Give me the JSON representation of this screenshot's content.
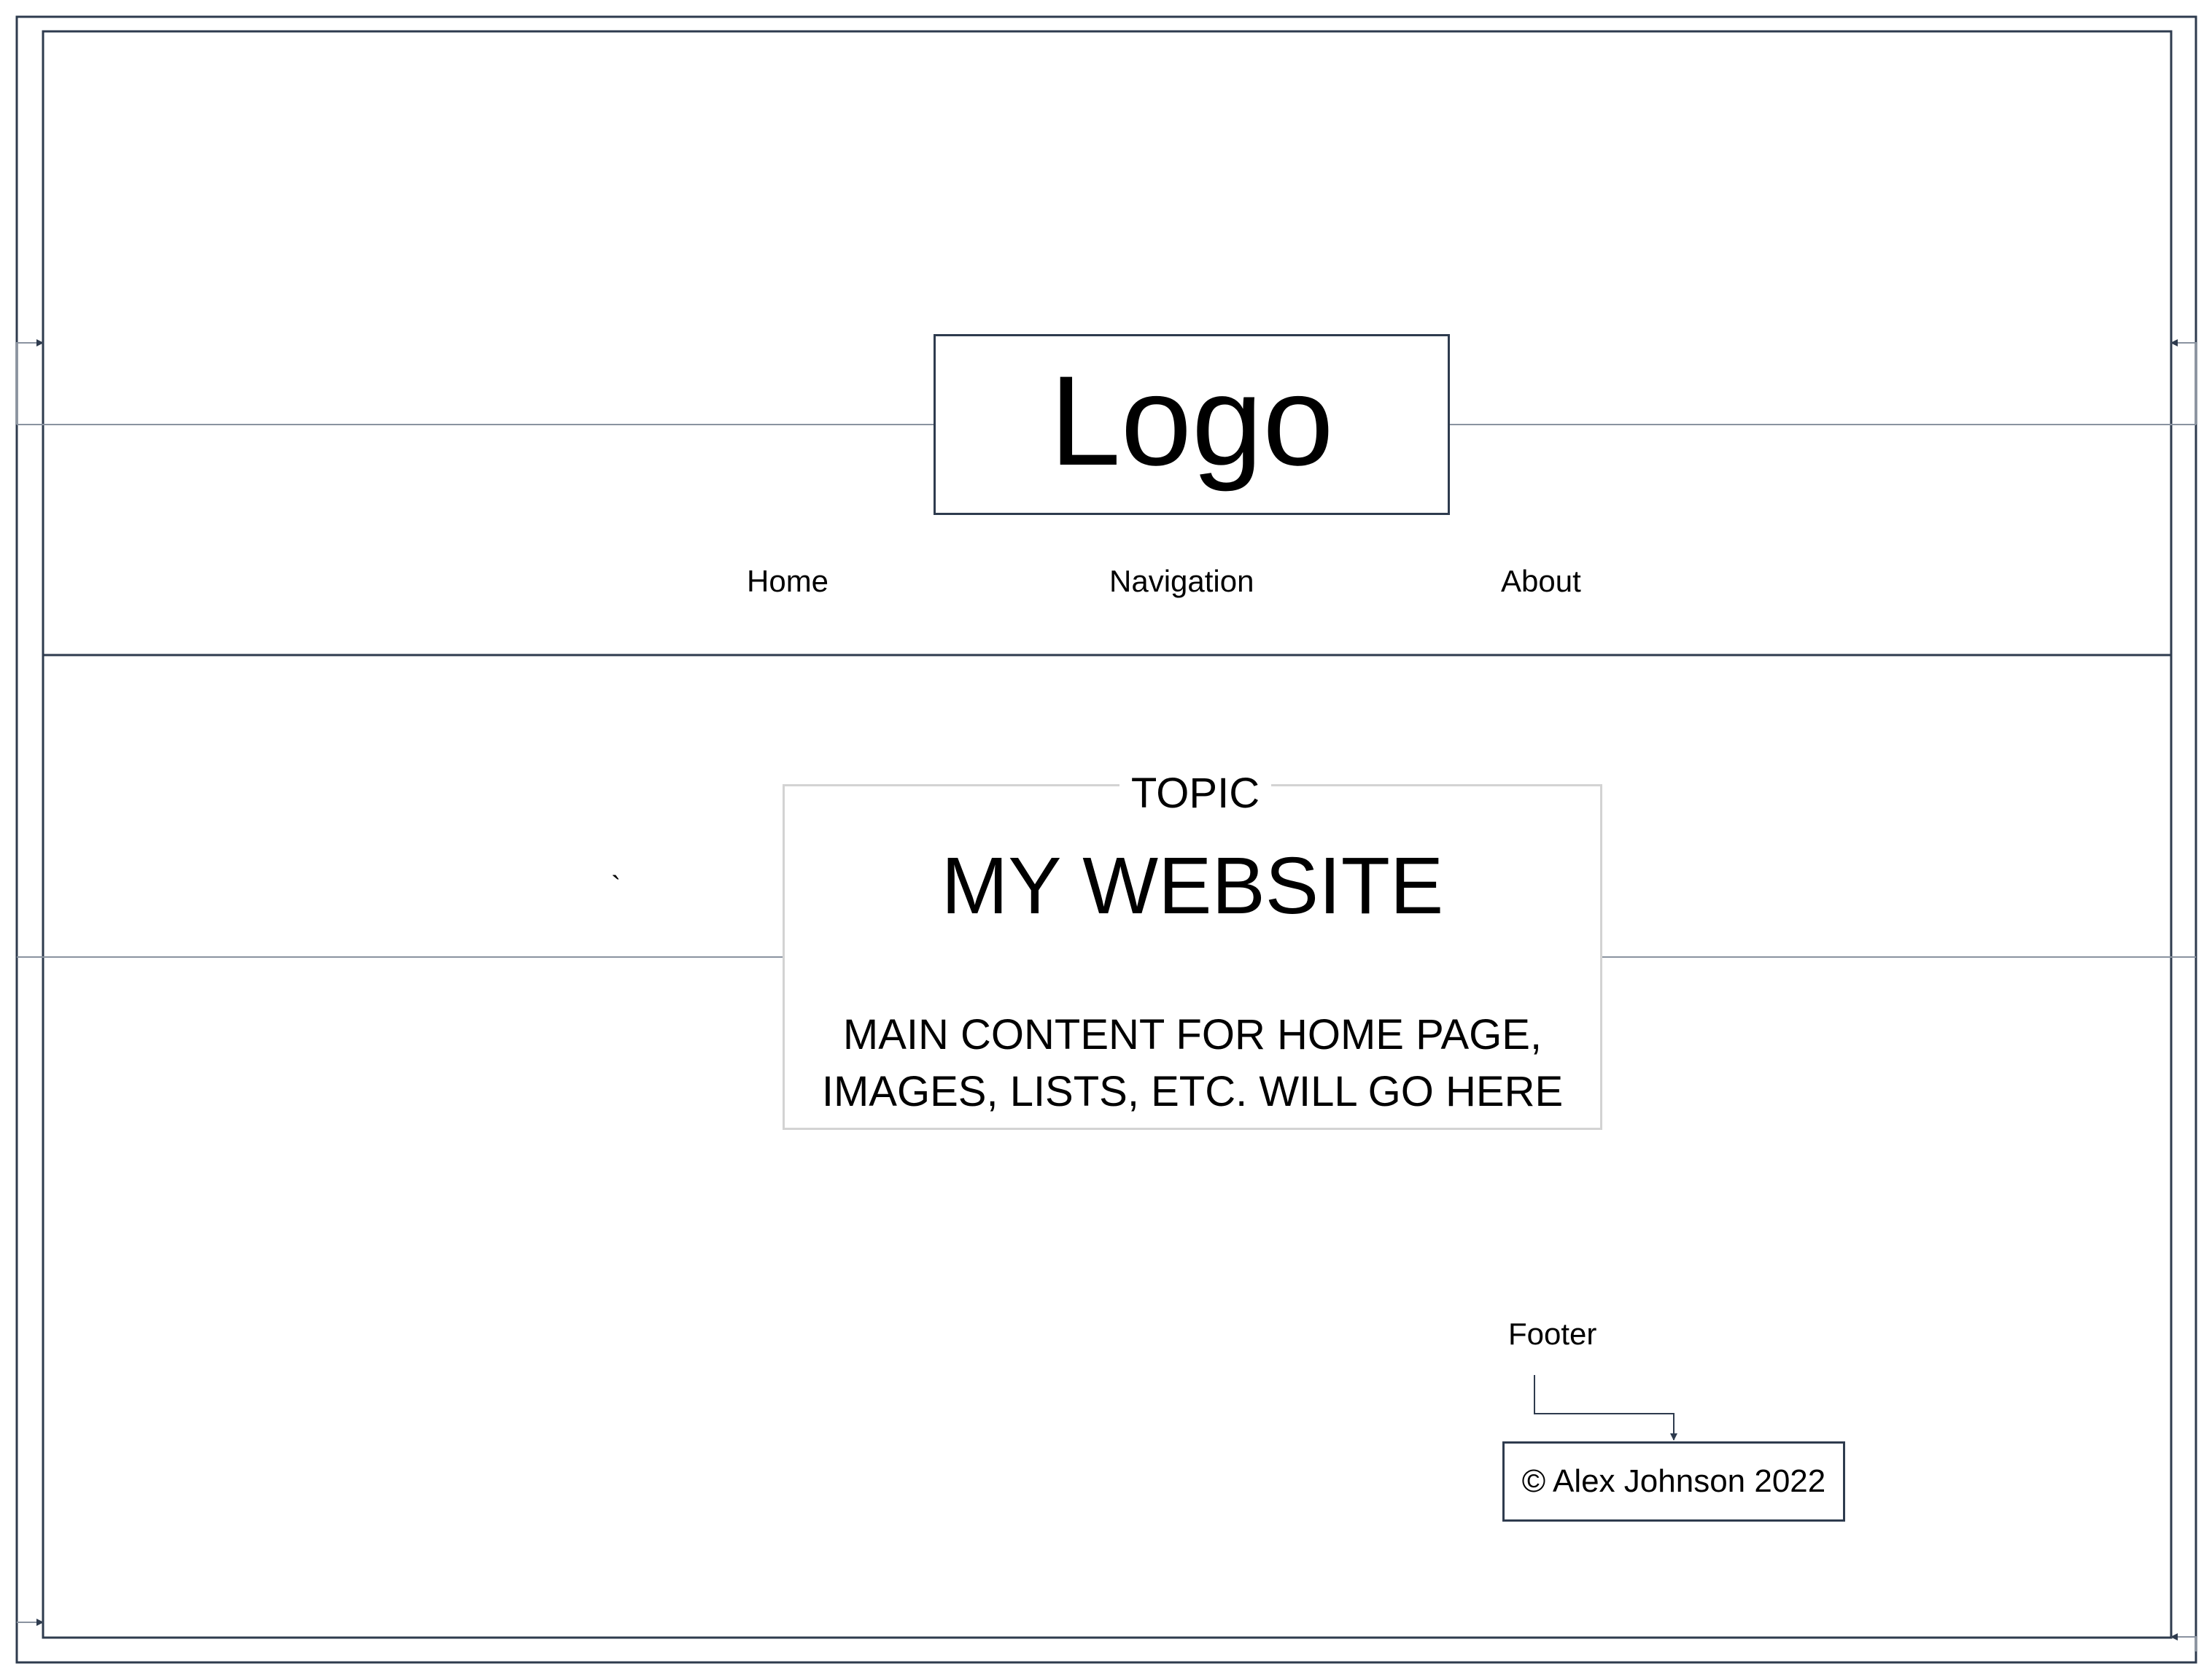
{
  "header": {
    "logo_text": "Logo",
    "nav": [
      "Home",
      "Navigation",
      "About"
    ]
  },
  "main": {
    "stray_mark": "`",
    "topic_label": "TOPIC",
    "site_title": "MY WEBSITE",
    "content_line_1": "MAIN CONTENT FOR HOME PAGE,",
    "content_line_2": "IMAGES, LISTS, ETC. WILL GO HERE"
  },
  "footer": {
    "label": "Footer",
    "copyright": "© Alex Johnson 2022"
  },
  "colors": {
    "frame_stroke": "#2e3b4e",
    "guide_stroke": "#8a93a0",
    "content_border": "#d3d3d3"
  }
}
